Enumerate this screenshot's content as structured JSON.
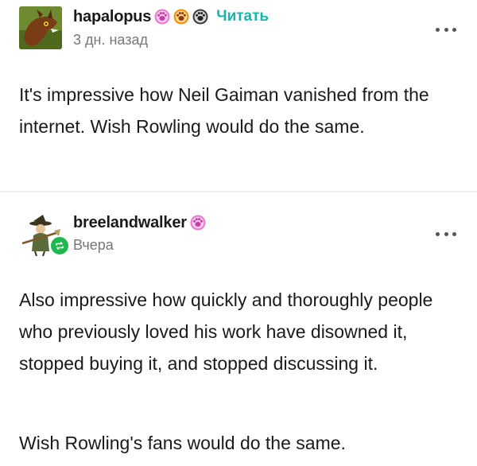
{
  "posts": [
    {
      "username": "hapalopus",
      "badges": [
        "paw-badge-pink",
        "paw-badge-orange",
        "paw-badge-dark"
      ],
      "follow_label": "Читать",
      "timestamp": "3 дн. назад",
      "body": [
        "It's impressive how Neil Gaiman vanished from the internet. Wish Rowling would do the same."
      ]
    },
    {
      "username": "breelandwalker",
      "badges": [
        "paw-badge-pink"
      ],
      "timestamp": "Вчера",
      "body": [
        "Also impressive how quickly and thoroughly people who previously loved his work have disowned it, stopped buying it, and stopped discussing it.",
        "Wish Rowling's fans would do the same."
      ]
    }
  ],
  "colors": {
    "follow": "#19b6a8",
    "reblog": "#1fb84f",
    "badge_pink": "#e679c9",
    "badge_orange": "#ff8a00",
    "badge_dark": "#3b3b3b"
  }
}
